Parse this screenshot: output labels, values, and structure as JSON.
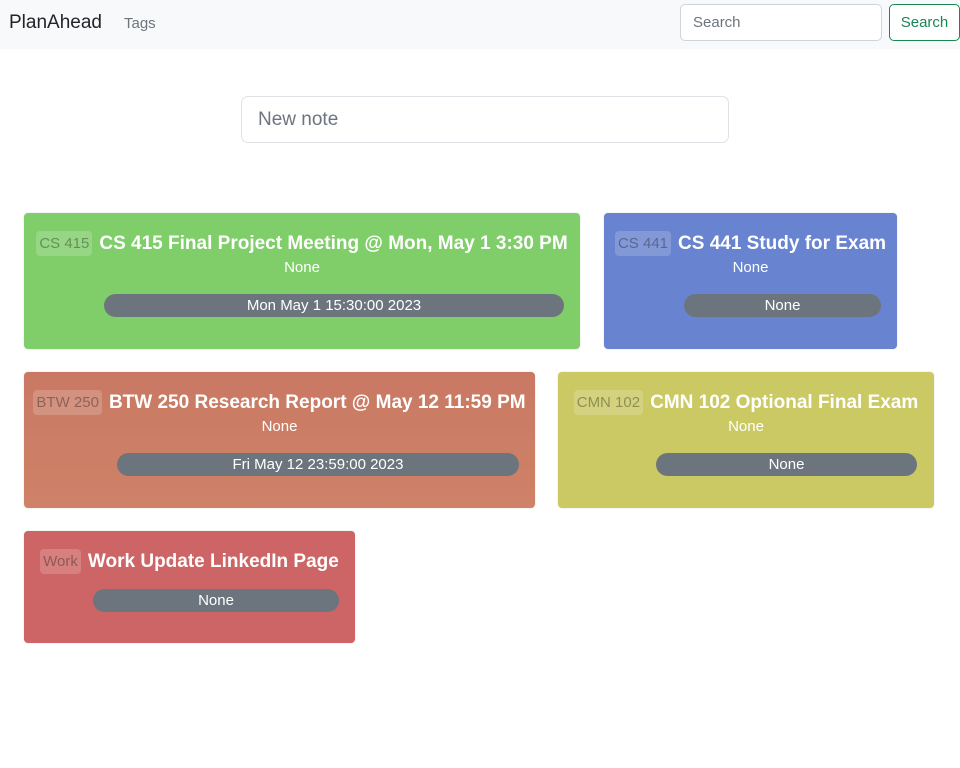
{
  "navbar": {
    "brand": "PlanAhead",
    "tags_link": "Tags",
    "search_placeholder": "Search",
    "search_button": "Search"
  },
  "new_note": {
    "placeholder": "New note"
  },
  "colors": {
    "card_cs415": "#7fce69",
    "card_cs441": "#6883cf",
    "card_btw250": "#cd7d65",
    "card_cmn102": "#cbc963",
    "card_work": "#cd6465",
    "pill": "#6c757d",
    "search_button": "#198754"
  },
  "notes": [
    {
      "tag": "CS 415",
      "title": "CS 415 Final Project Meeting @ Mon, May 1 3:30 PM",
      "description": "None",
      "due": "Mon May 1 15:30:00 2023"
    },
    {
      "tag": "CS 441",
      "title": "CS 441 Study for Exam",
      "description": "None",
      "due": "None"
    },
    {
      "tag": "BTW 250",
      "title": "BTW 250 Research Report @ May 12 11:59 PM",
      "description": "None",
      "due": "Fri May 12 23:59:00 2023"
    },
    {
      "tag": "CMN 102",
      "title": "CMN 102 Optional Final Exam",
      "description": "None",
      "due": "None"
    },
    {
      "tag": "Work",
      "title": "Work Update LinkedIn Page",
      "due": "None"
    }
  ]
}
